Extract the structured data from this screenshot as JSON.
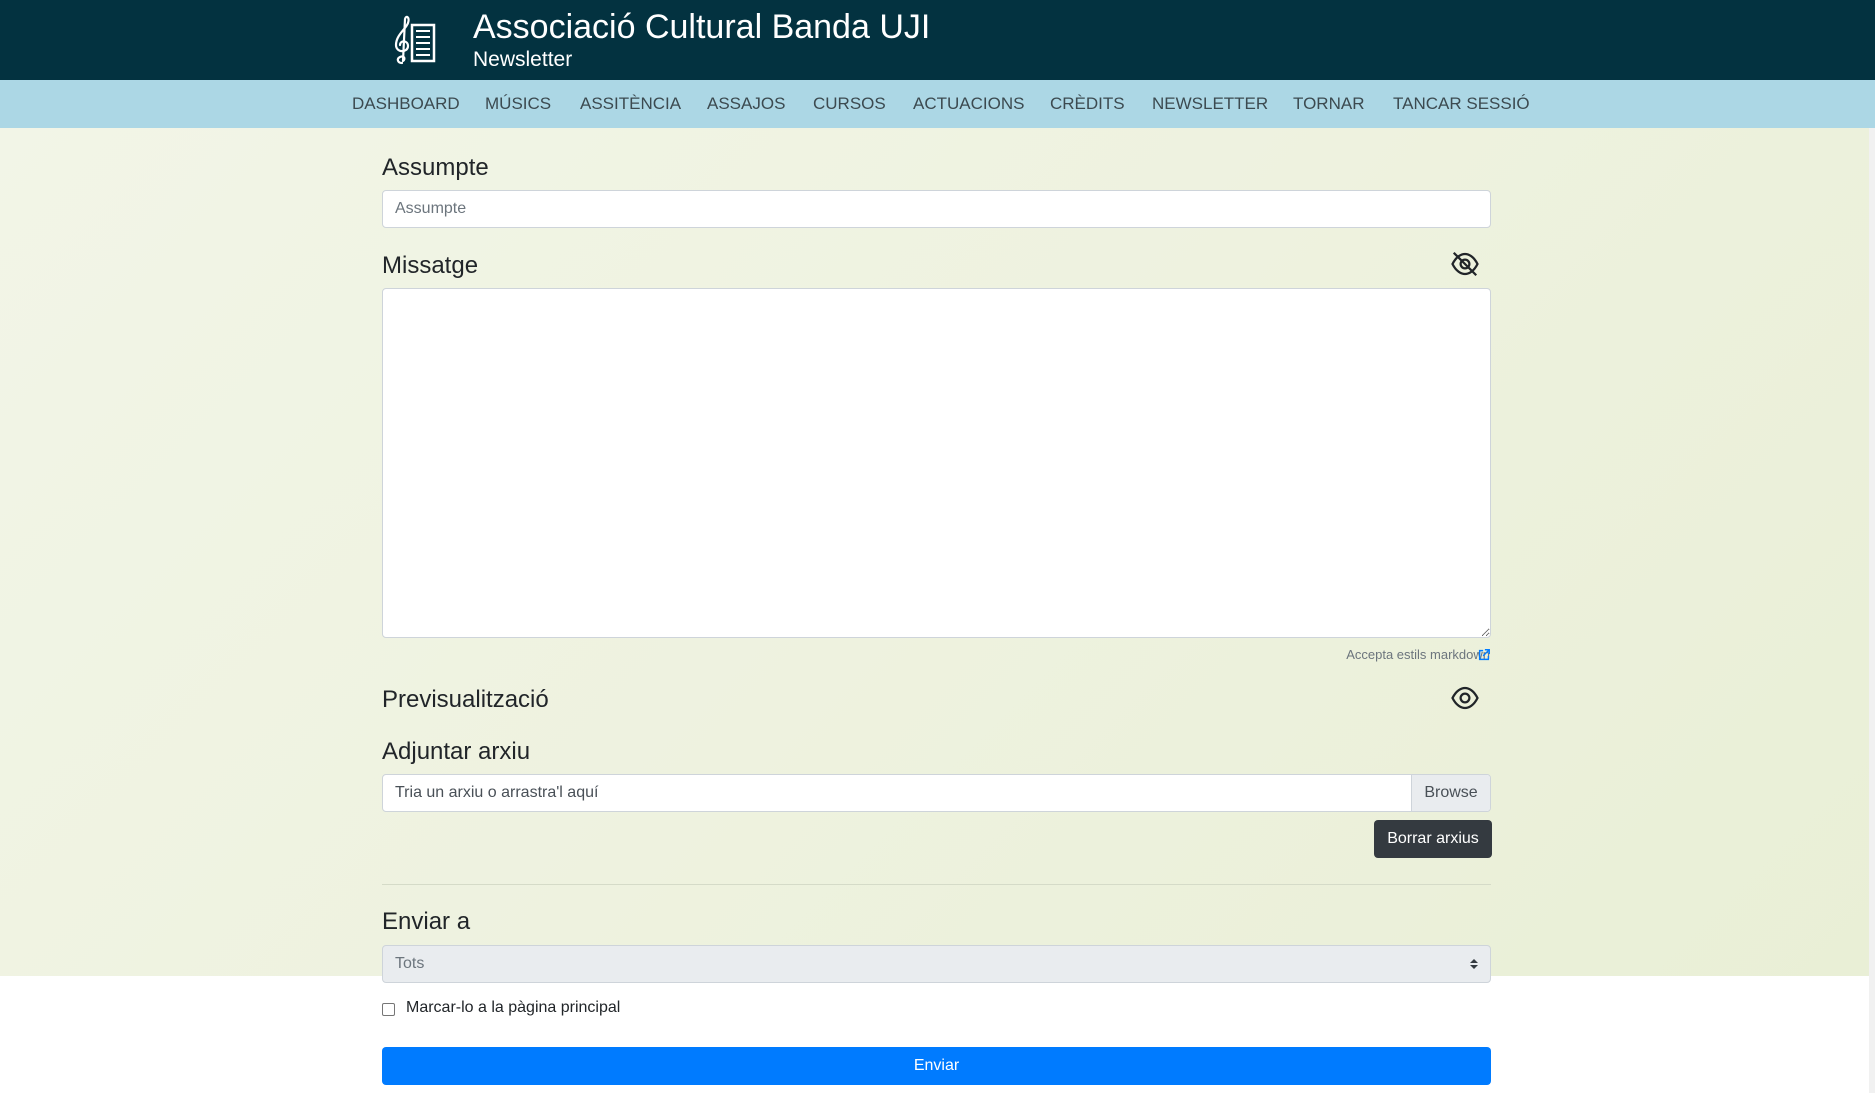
{
  "header": {
    "title": "Associació Cultural Banda UJI",
    "subtitle": "Newsletter",
    "logo_icon": "music-stand-treble-clef-icon"
  },
  "nav": {
    "items": [
      {
        "label": "DASHBOARD"
      },
      {
        "label": "MÚSICS"
      },
      {
        "label": "ASSITÈNCIA"
      },
      {
        "label": "ASSAJOS"
      },
      {
        "label": "CURSOS"
      },
      {
        "label": "ACTUACIONS"
      },
      {
        "label": "CRÈDITS"
      },
      {
        "label": "NEWSLETTER"
      },
      {
        "label": "TORNAR"
      },
      {
        "label": "TANCAR SESSIÓ"
      }
    ]
  },
  "form": {
    "subject": {
      "label": "Assumpte",
      "value": "",
      "placeholder": "Assumpte"
    },
    "message": {
      "label": "Missatge",
      "value": "",
      "toggle_icon": "eye-off-icon",
      "hint": "Accepta estils markdown",
      "hint_icon": "external-link-icon"
    },
    "preview": {
      "label": "Previsualització",
      "toggle_icon": "eye-icon"
    },
    "attachment": {
      "label": "Adjuntar arxiu",
      "placeholder": "Tria un arxiu o arrastra'l aquí",
      "browse_label": "Browse",
      "clear_label": "Borrar arxius"
    },
    "recipients": {
      "label": "Enviar a",
      "selected": "Tots"
    },
    "pin": {
      "label": "Marcar-lo a la pàgina principal",
      "checked": false
    },
    "submit_label": "Enviar"
  },
  "colors": {
    "header_bg": "#033240",
    "nav_bg": "#acd7e5",
    "page_bg": "#eef2df",
    "primary": "#007bff",
    "dark_button": "#343a40"
  }
}
